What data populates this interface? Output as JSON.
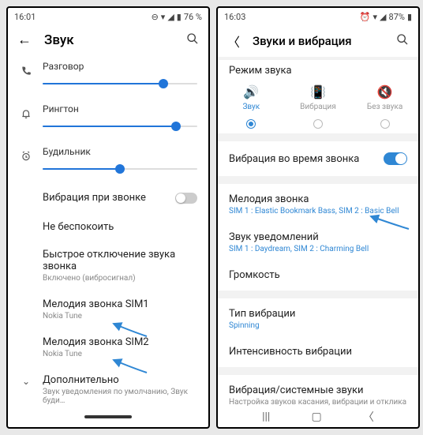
{
  "left": {
    "status": {
      "time": "16:01",
      "battery": "76 %"
    },
    "header": {
      "title": "Звук"
    },
    "sliders": {
      "talk": {
        "label": "Разговор",
        "pct": 78
      },
      "ring": {
        "label": "Рингтон",
        "pct": 86
      },
      "alarm": {
        "label": "Будильник",
        "pct": 50
      }
    },
    "vibrate": {
      "label": "Вибрация при звонке"
    },
    "dnd": {
      "title": "Не беспокоить"
    },
    "quickmute": {
      "title": "Быстрое отключение звука звонка",
      "sub": "Включено (вибросигнал)"
    },
    "sim1": {
      "title": "Мелодия звонка SIM1",
      "sub": "Nokia Tune"
    },
    "sim2": {
      "title": "Мелодия звонка SIM2",
      "sub": "Nokia Tune"
    },
    "more": {
      "title": "Дополнительно",
      "sub": "Звук уведомления по умолчанию, Звук буди…"
    }
  },
  "right": {
    "status": {
      "time": "16:03",
      "battery": "87%"
    },
    "header": {
      "title": "Звуки и вибрация"
    },
    "mode": {
      "title": "Режим звука",
      "sound": "Звук",
      "vibrate": "Вибрация",
      "silent": "Без звука"
    },
    "vibcall": {
      "label": "Вибрация во время звонка"
    },
    "ringtone": {
      "title": "Мелодия звонка",
      "sub": "SIM 1 : Elastic Bookmark Bass, SIM 2 : Basic Bell"
    },
    "notif": {
      "title": "Звук уведомлений",
      "sub": "SIM 1 : Daydream, SIM 2 : Charming Bell"
    },
    "volume": {
      "title": "Громкость"
    },
    "vibtype": {
      "title": "Тип вибрации",
      "sub": "Spinning"
    },
    "intensity": {
      "title": "Интенсивность вибрации"
    },
    "system": {
      "title": "Вибрация/системные звуки",
      "sub": "Настройка звуков касания, вибрации и отклика клавиатуры."
    }
  }
}
